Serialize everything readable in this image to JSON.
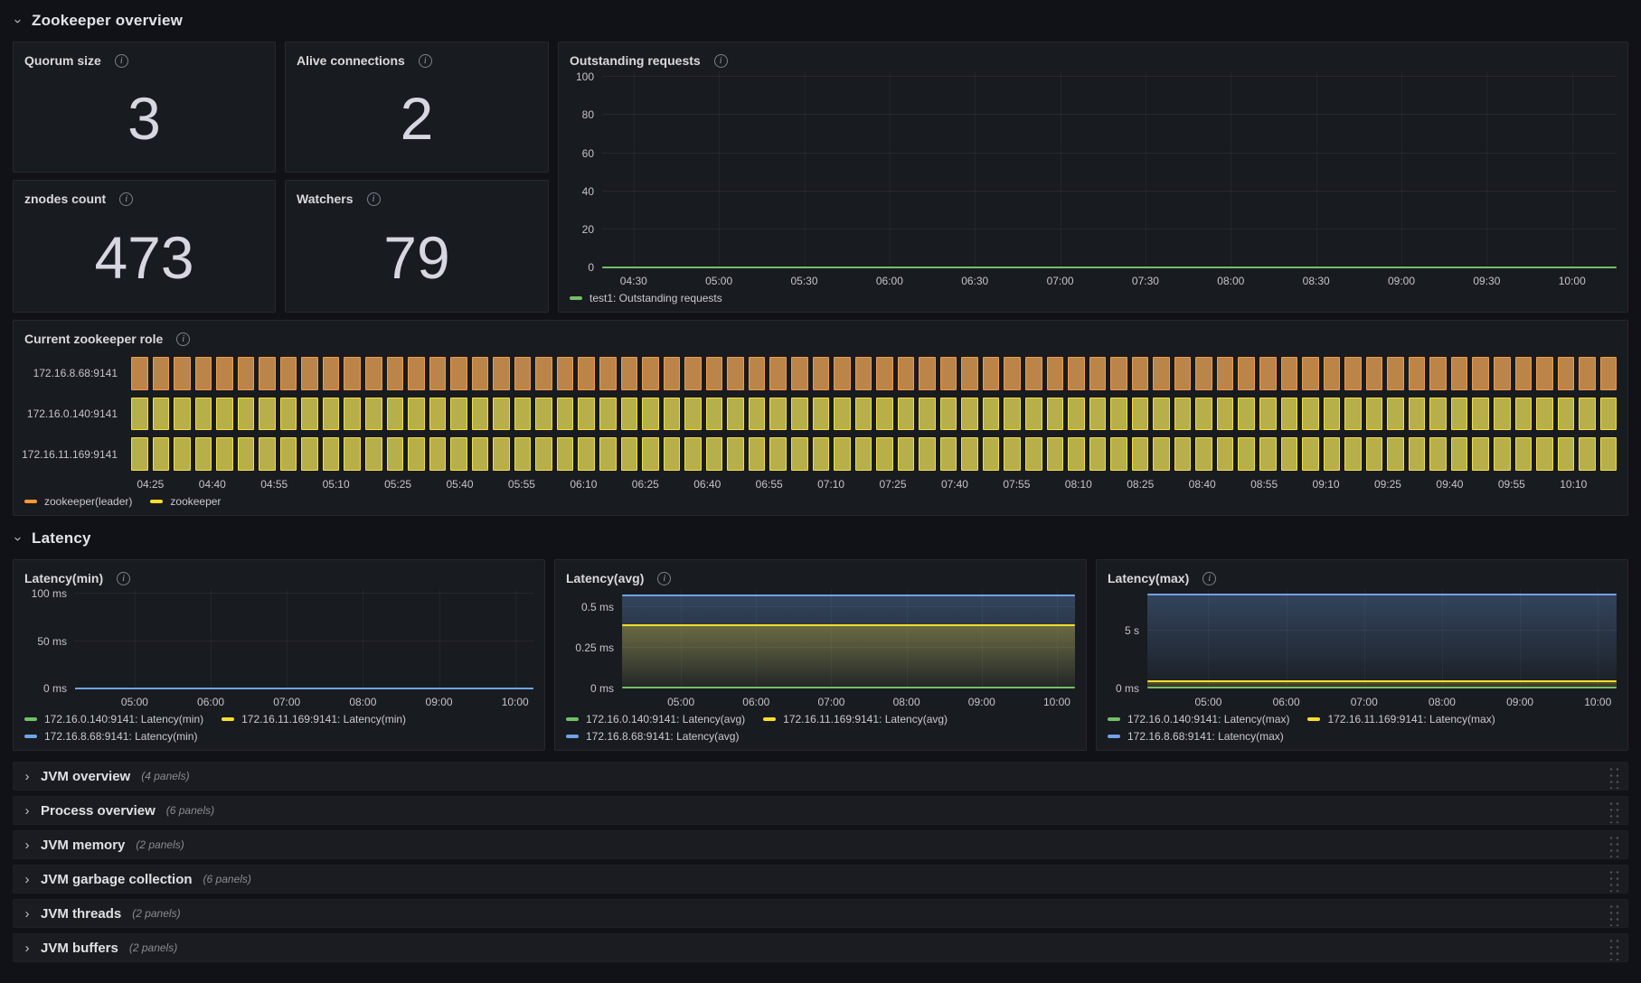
{
  "sections": {
    "overview": {
      "title": "Zookeeper overview"
    },
    "latency": {
      "title": "Latency"
    }
  },
  "stats": [
    {
      "title": "Quorum size",
      "value": "3"
    },
    {
      "title": "Alive connections",
      "value": "2"
    },
    {
      "title": "znodes count",
      "value": "473"
    },
    {
      "title": "Watchers",
      "value": "79"
    }
  ],
  "collapsed_rows": [
    {
      "title": "JVM overview",
      "count": "(4 panels)"
    },
    {
      "title": "Process overview",
      "count": "(6 panels)"
    },
    {
      "title": "JVM memory",
      "count": "(2 panels)"
    },
    {
      "title": "JVM garbage collection",
      "count": "(6 panels)"
    },
    {
      "title": "JVM threads",
      "count": "(2 panels)"
    },
    {
      "title": "JVM buffers",
      "count": "(2 panels)"
    }
  ],
  "chart_data": [
    {
      "id": "outstanding_requests",
      "type": "line",
      "title": "Outstanding requests",
      "ylim": [
        0,
        100
      ],
      "ymax_draw": 103,
      "grid": true,
      "legend_position": "bottom-left",
      "yticks": [
        {
          "label": "100",
          "value": 100
        },
        {
          "label": "80",
          "value": 80
        },
        {
          "label": "60",
          "value": 60
        },
        {
          "label": "40",
          "value": 40
        },
        {
          "label": "20",
          "value": 20
        },
        {
          "label": "0",
          "value": 0
        }
      ],
      "xticks": [
        "04:30",
        "05:00",
        "05:30",
        "06:00",
        "06:30",
        "07:00",
        "07:30",
        "08:00",
        "08:30",
        "09:00",
        "09:30",
        "10:00"
      ],
      "x_start_pct": 3.1,
      "x_step_pct": 8.41,
      "ylabel_width": 36,
      "series": [
        {
          "name": "test1: Outstanding requests",
          "color": "#73bf69",
          "value": 0,
          "fill": false
        }
      ],
      "legend": [
        {
          "label": "test1: Outstanding requests",
          "color": "#73bf69"
        }
      ]
    },
    {
      "id": "zookeeper_role",
      "type": "state-timeline",
      "title": "Current zookeeper role",
      "rows": [
        {
          "label": "172.16.8.68:9141",
          "state": "zookeeper(leader)"
        },
        {
          "label": "172.16.0.140:9141",
          "state": "zookeeper"
        },
        {
          "label": "172.16.11.169:9141",
          "state": "zookeeper"
        }
      ],
      "states": {
        "zookeeper(leader)": {
          "fill": "#bb8549",
          "border": "#f29a4a"
        },
        "zookeeper": {
          "fill": "#b7af4a",
          "border": "#f5e03c"
        }
      },
      "cells_per_row": 70,
      "xticks": [
        "04:25",
        "04:40",
        "04:55",
        "05:10",
        "05:25",
        "05:40",
        "05:55",
        "06:10",
        "06:25",
        "06:40",
        "06:55",
        "07:10",
        "07:25",
        "07:40",
        "07:55",
        "08:10",
        "08:25",
        "08:40",
        "08:55",
        "09:10",
        "09:25",
        "09:40",
        "09:55",
        "10:10"
      ],
      "x_start_pct": 1.3,
      "x_step_pct": 4.165,
      "legend": [
        {
          "label": "zookeeper(leader)",
          "color": "#ff9830"
        },
        {
          "label": "zookeeper",
          "color": "#fade2a"
        }
      ]
    },
    {
      "id": "latency_min",
      "type": "line",
      "title": "Latency(min)",
      "ylim": [
        0,
        100
      ],
      "ymax_draw": 105,
      "grid": true,
      "legend_position": "bottom-left",
      "yticks": [
        {
          "label": "100 ms",
          "value": 100
        },
        {
          "label": "50 ms",
          "value": 50
        },
        {
          "label": "0 ms",
          "value": 0
        }
      ],
      "xticks": [
        "05:00",
        "06:00",
        "07:00",
        "08:00",
        "09:00",
        "10:00"
      ],
      "x_start_pct": 13.0,
      "x_step_pct": 16.6,
      "ylabel_width": 56,
      "series": [
        {
          "name": "172.16.0.140:9141: Latency(min)",
          "color": "#73bf69",
          "value": 0,
          "fill": false
        },
        {
          "name": "172.16.11.169:9141: Latency(min)",
          "color": "#fade2a",
          "value": 0,
          "fill": false
        },
        {
          "name": "172.16.8.68:9141: Latency(min)",
          "color": "#72a2e9",
          "value": 0,
          "fill": false
        }
      ],
      "legend": [
        {
          "label": "172.16.0.140:9141: Latency(min)",
          "color": "#73bf69"
        },
        {
          "label": "172.16.11.169:9141: Latency(min)",
          "color": "#fade2a"
        },
        {
          "label": "172.16.8.68:9141: Latency(min)",
          "color": "#72a2e9"
        }
      ]
    },
    {
      "id": "latency_avg",
      "type": "line",
      "title": "Latency(avg)",
      "ylim": [
        0,
        0.61
      ],
      "ymax_draw": 0.61,
      "unit": "ms",
      "grid": true,
      "legend_position": "bottom-left",
      "yticks": [
        {
          "label": "0.5 ms",
          "value": 0.5
        },
        {
          "label": "0.25 ms",
          "value": 0.25
        },
        {
          "label": "0 ms",
          "value": 0
        }
      ],
      "xticks": [
        "05:00",
        "06:00",
        "07:00",
        "08:00",
        "09:00",
        "10:00"
      ],
      "x_start_pct": 13.0,
      "x_step_pct": 16.6,
      "ylabel_width": 62,
      "series": [
        {
          "name": "172.16.0.140:9141: Latency(avg)",
          "color": "#73bf69",
          "value": 0.005,
          "fill": false
        },
        {
          "name": "172.16.11.169:9141: Latency(avg)",
          "color": "#fade2a",
          "value": 0.39,
          "fill": true
        },
        {
          "name": "172.16.8.68:9141: Latency(avg)",
          "color": "#72a2e9",
          "value": 0.57,
          "fill": true
        }
      ],
      "legend": [
        {
          "label": "172.16.0.140:9141: Latency(avg)",
          "color": "#73bf69"
        },
        {
          "label": "172.16.11.169:9141: Latency(avg)",
          "color": "#fade2a"
        },
        {
          "label": "172.16.8.68:9141: Latency(avg)",
          "color": "#72a2e9"
        }
      ]
    },
    {
      "id": "latency_max",
      "type": "line",
      "title": "Latency(max)",
      "ylim": [
        0,
        8.6
      ],
      "ymax_draw": 8.6,
      "unit": "s",
      "grid": true,
      "legend_position": "bottom-left",
      "yticks": [
        {
          "label": "5 s",
          "value": 5
        },
        {
          "label": "0 ms",
          "value": 0
        }
      ],
      "xticks": [
        "05:00",
        "06:00",
        "07:00",
        "08:00",
        "09:00",
        "10:00"
      ],
      "x_start_pct": 13.0,
      "x_step_pct": 16.6,
      "ylabel_width": 44,
      "series": [
        {
          "name": "172.16.0.140:9141: Latency(max)",
          "color": "#73bf69",
          "value": 0.1,
          "fill": false
        },
        {
          "name": "172.16.11.169:9141: Latency(max)",
          "color": "#fade2a",
          "value": 0.65,
          "fill": true
        },
        {
          "name": "172.16.8.68:9141: Latency(max)",
          "color": "#72a2e9",
          "value": 8.1,
          "fill": true
        }
      ],
      "legend": [
        {
          "label": "172.16.0.140:9141: Latency(max)",
          "color": "#73bf69"
        },
        {
          "label": "172.16.11.169:9141: Latency(max)",
          "color": "#fade2a"
        },
        {
          "label": "172.16.8.68:9141: Latency(max)",
          "color": "#72a2e9"
        }
      ]
    }
  ]
}
